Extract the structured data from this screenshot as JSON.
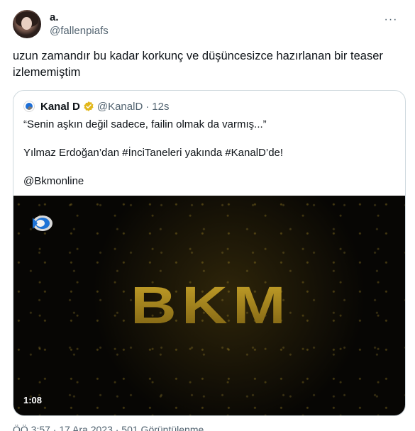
{
  "tweet": {
    "display_name": "a.",
    "handle": "@fallenpiafs",
    "more_label": "···",
    "text": "uzun zamandır bu kadar korkunç ve düşüncesizce hazırlanan bir teaser izlememiştim",
    "meta": "ÖÖ 3:57 · 17 Ara 2023 · 501 Görüntülenme"
  },
  "quote": {
    "name": "Kanal D",
    "handle": "@KanalD",
    "dot": "·",
    "time": "12s",
    "line1": "“Senin aşkın değil sadece, failin olmak da varmış...”",
    "line2": "Yılmaz Erdoğan’dan #İnciTaneleri yakında #KanalD’de!",
    "line3": "@Bkmonline",
    "video_duration": "1:08",
    "logo_text": "BKM"
  },
  "colors": {
    "verified_badge": "#e2b719",
    "gold": "#b8961f",
    "secondary_text": "#536471",
    "border": "#cfd9de"
  },
  "icons": {
    "more": "more-horizontal-icon",
    "verified": "gold-verified-badge-icon",
    "channel": "kanal-d-logo-icon"
  }
}
